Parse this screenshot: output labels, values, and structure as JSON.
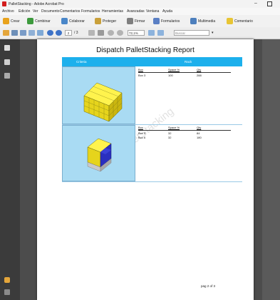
{
  "window": {
    "title": "PalletStacking - Adobe Acrobat Pro",
    "min_glyph": "–"
  },
  "menu": [
    "Archivo",
    "Edición",
    "Ver",
    "Documento",
    "Comentarios",
    "Formularios",
    "Herramientas",
    "Avanzadas",
    "Ventana",
    "Ayuda"
  ],
  "tasks": [
    "Crear",
    "Combinar",
    "Colaborar",
    "Proteger",
    "Firmar",
    "Formularios",
    "Multimedia",
    "Comentario"
  ],
  "nav": {
    "page_current": "2",
    "page_total": "/ 3",
    "zoom": "72,1%",
    "search_placeholder": "Buscar"
  },
  "report": {
    "title": "Dispatch PalletStacking Report",
    "col_left": "Criteria",
    "col_right": "Rack",
    "watermark": "PalletStacking",
    "footer": "pag  2   of 3",
    "items": [
      {
        "headers": [
          "Box",
          "Space %",
          "Qty"
        ],
        "rows": [
          [
            "Box 3",
            "100",
            "288"
          ]
        ]
      },
      {
        "headers": [
          "Box",
          "Space %",
          "Qty"
        ],
        "rows": [
          [
            "Box 5",
            "32",
            "84"
          ],
          [
            "Box 6",
            "32",
            "180"
          ]
        ]
      }
    ]
  },
  "colors": {
    "header_blue": "#1db0ec",
    "cell_blue": "#a9dbf3",
    "panel_dark": "#3b3b3b",
    "workspace": "#4c4c4c"
  }
}
